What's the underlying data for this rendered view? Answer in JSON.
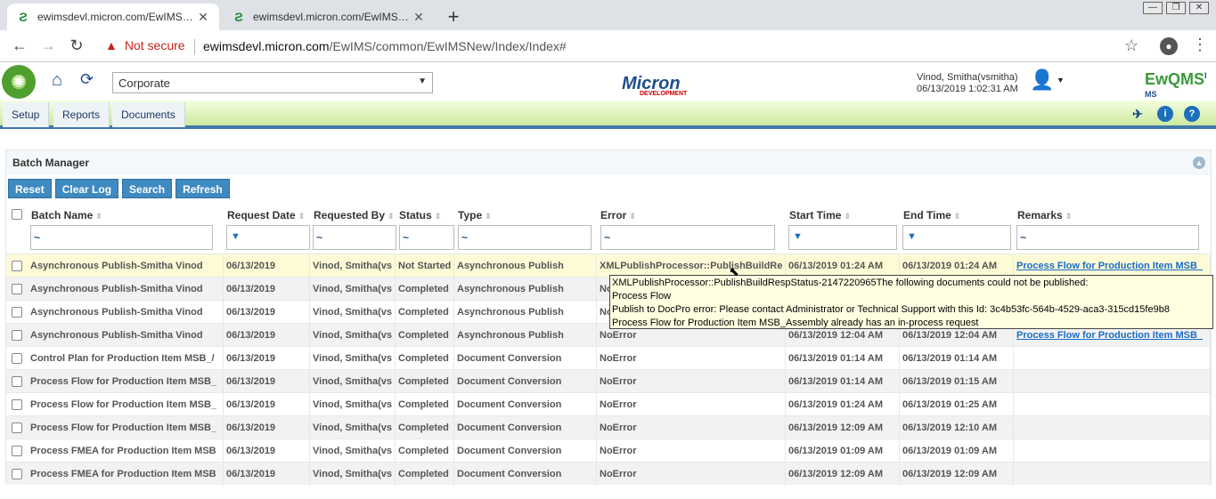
{
  "browser": {
    "tabs": [
      {
        "title": "ewimsdevl.micron.com/EwIMS/co"
      },
      {
        "title": "ewimsdevl.micron.com/EwIMS/co"
      }
    ],
    "new_tab": "+",
    "security_label": "Not secure",
    "url_host": "ewimsdevl.micron.com",
    "url_path": "/EwIMS/common/EwIMSNew/Index/Index#"
  },
  "header": {
    "site_select": "Corporate",
    "brand": "Micron",
    "brand_sub": "DEVELOPMENT",
    "user_name": "Vinod, Smitha(vsmitha)",
    "user_datetime": "06/13/2019 1:02:31 AM",
    "app_logo": "EwQMS",
    "app_logo_sup": "I MS"
  },
  "menu": {
    "items": [
      "Setup",
      "Reports",
      "Documents"
    ]
  },
  "panel": {
    "title": "Batch Manager",
    "buttons": {
      "reset": "Reset",
      "clear_log": "Clear Log",
      "search": "Search",
      "refresh": "Refresh"
    }
  },
  "grid": {
    "columns": [
      "Batch Name",
      "Request Date",
      "Requested By",
      "Status",
      "Type",
      "Error",
      "Start Time",
      "End Time",
      "Remarks"
    ],
    "filters": [
      "~",
      "",
      "~",
      "~",
      "~",
      "~",
      "",
      "",
      "~"
    ],
    "rows": [
      [
        "Asynchronous Publish-Smitha Vinod",
        "06/13/2019",
        "Vinod, Smitha(vs",
        "Not Started",
        "Asynchronous Publish",
        "XMLPublishProcessor::PublishBuildRe",
        "06/13/2019 01:24 AM",
        "06/13/2019 01:24 AM",
        "Process Flow for Production Item MSB_"
      ],
      [
        "Asynchronous Publish-Smitha Vinod",
        "06/13/2019",
        "Vinod, Smitha(vs",
        "Completed",
        "Asynchronous Publish",
        "No",
        "",
        "",
        ""
      ],
      [
        "Asynchronous Publish-Smitha Vinod",
        "06/13/2019",
        "Vinod, Smitha(vs",
        "Completed",
        "Asynchronous Publish",
        "No",
        "",
        "",
        ""
      ],
      [
        "Asynchronous Publish-Smitha Vinod",
        "06/13/2019",
        "Vinod, Smitha(vs",
        "Completed",
        "Asynchronous Publish",
        "NoError",
        "06/13/2019 12:04 AM",
        "06/13/2019 12:04 AM",
        "Process Flow for Production Item MSB_"
      ],
      [
        "Control Plan for Production Item MSB_/",
        "06/13/2019",
        "Vinod, Smitha(vs",
        "Completed",
        "Document Conversion",
        "NoError",
        "06/13/2019 01:14 AM",
        "06/13/2019 01:14 AM",
        ""
      ],
      [
        "Process Flow for Production Item MSB_",
        "06/13/2019",
        "Vinod, Smitha(vs",
        "Completed",
        "Document Conversion",
        "NoError",
        "06/13/2019 01:14 AM",
        "06/13/2019 01:15 AM",
        ""
      ],
      [
        "Process Flow for Production Item MSB_",
        "06/13/2019",
        "Vinod, Smitha(vs",
        "Completed",
        "Document Conversion",
        "NoError",
        "06/13/2019 01:24 AM",
        "06/13/2019 01:25 AM",
        ""
      ],
      [
        "Process Flow for Production Item MSB_",
        "06/13/2019",
        "Vinod, Smitha(vs",
        "Completed",
        "Document Conversion",
        "NoError",
        "06/13/2019 12:09 AM",
        "06/13/2019 12:10 AM",
        ""
      ],
      [
        "Process FMEA for Production Item MSB",
        "06/13/2019",
        "Vinod, Smitha(vs",
        "Completed",
        "Document Conversion",
        "NoError",
        "06/13/2019 01:09 AM",
        "06/13/2019 01:09 AM",
        ""
      ],
      [
        "Process FMEA for Production Item MSB",
        "06/13/2019",
        "Vinod, Smitha(vs",
        "Completed",
        "Document Conversion",
        "NoError",
        "06/13/2019 12:09 AM",
        "06/13/2019 12:09 AM",
        ""
      ]
    ]
  },
  "tooltip": {
    "lines": [
      "XMLPublishProcessor::PublishBuildRespStatus-2147220965The following documents could not be published:",
      "Process Flow",
      "Publish to DocPro error:  Please contact Administrator or Technical Support with this Id: 3c4b53fc-564b-4529-aca3-315cd15fe9b8",
      "Process Flow for Production Item MSB_Assembly already has an in-process request"
    ]
  }
}
